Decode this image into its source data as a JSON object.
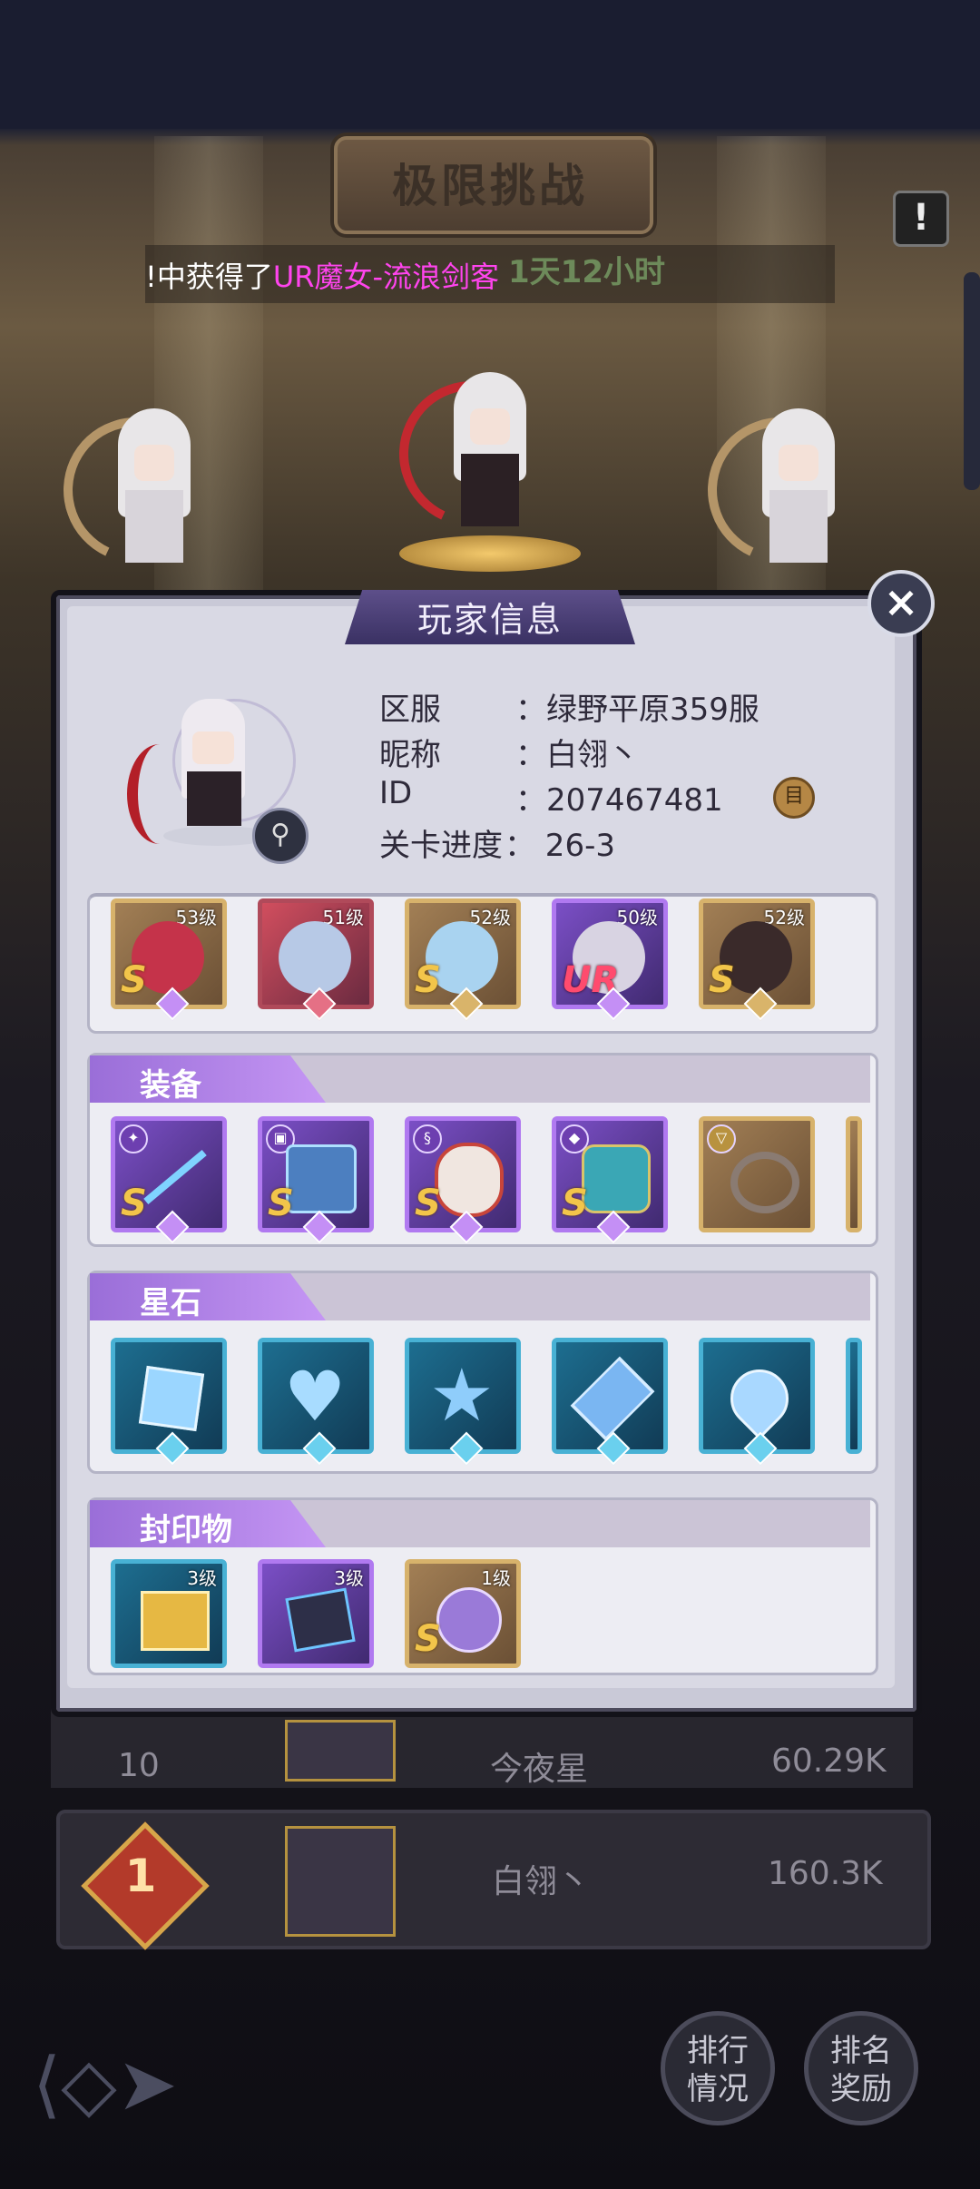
{
  "header": {
    "title": "极限挑战",
    "countdown": "1天12小时",
    "notice_text": "!中获得了",
    "notice_highlight": "UR魔女-流浪剑客",
    "warn_icon": "!"
  },
  "player_info": {
    "title": "玩家信息",
    "close_icon": "×",
    "rows": [
      {
        "label": "区服",
        "value": "：绿野平原359服"
      },
      {
        "label": "昵称",
        "value": "：白翎丶"
      },
      {
        "label": "ID",
        "value": "：207467481"
      },
      {
        "label": "关卡进度",
        "value": "：  26-3"
      }
    ],
    "copy_icon": "目"
  },
  "heroes": [
    {
      "level": "53级",
      "grade": "S"
    },
    {
      "level": "51级",
      "grade": ""
    },
    {
      "level": "52级",
      "grade": "S"
    },
    {
      "level": "50级",
      "grade": "UR"
    },
    {
      "level": "52级",
      "grade": "S"
    }
  ],
  "equipment": {
    "title": "装备",
    "items": [
      {
        "name": "spear",
        "grade": "S"
      },
      {
        "name": "book",
        "grade": "S"
      },
      {
        "name": "mask",
        "grade": "S"
      },
      {
        "name": "armor",
        "grade": "S"
      },
      {
        "name": "ring",
        "grade": ""
      }
    ]
  },
  "starstones": {
    "title": "星石",
    "items": [
      "square-gem",
      "heart-gem",
      "star-gem",
      "diamond-gem",
      "drop-gem"
    ]
  },
  "seals": {
    "title": "封印物",
    "items": [
      {
        "level": "3级",
        "grade": ""
      },
      {
        "level": "3级",
        "grade": ""
      },
      {
        "level": "1级",
        "grade": "S"
      }
    ]
  },
  "ranking": {
    "row1": {
      "rank": "10",
      "name": "今夜星",
      "score": "60.29K"
    },
    "row2": {
      "rank": "1",
      "name": "白翎丶",
      "score": "160.3K"
    }
  },
  "buttons": {
    "rank_status": "排行\n情况",
    "rank_reward": "排名\n奖励"
  }
}
